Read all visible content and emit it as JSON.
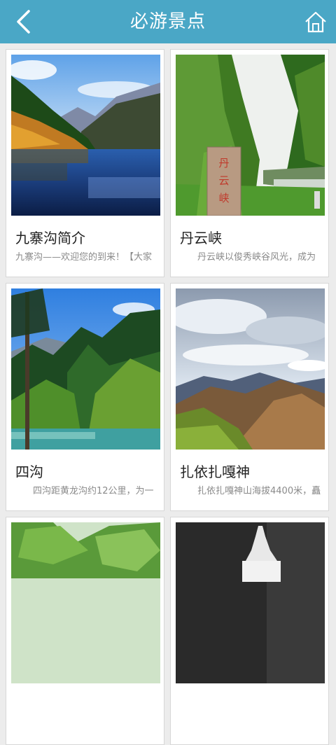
{
  "header": {
    "title": "必游景点",
    "back_icon": "back-chevron-icon",
    "home_icon": "home-icon"
  },
  "accent_color": "#4aa7c6",
  "spots": [
    {
      "name": "九寨沟简介",
      "desc": "九寨沟——欢迎您的到来！【大家"
    },
    {
      "name": "丹云峡",
      "desc": "丹云峡以俊秀峡谷风光，成为"
    },
    {
      "name": "四沟",
      "desc": "四沟距黄龙沟约12公里，为一"
    },
    {
      "name": "扎依扎嘎神",
      "desc": "扎依扎嘎神山海拔4400米，矗"
    },
    {
      "name": "",
      "desc": ""
    },
    {
      "name": "",
      "desc": ""
    }
  ],
  "stone_text": "丹云峡"
}
